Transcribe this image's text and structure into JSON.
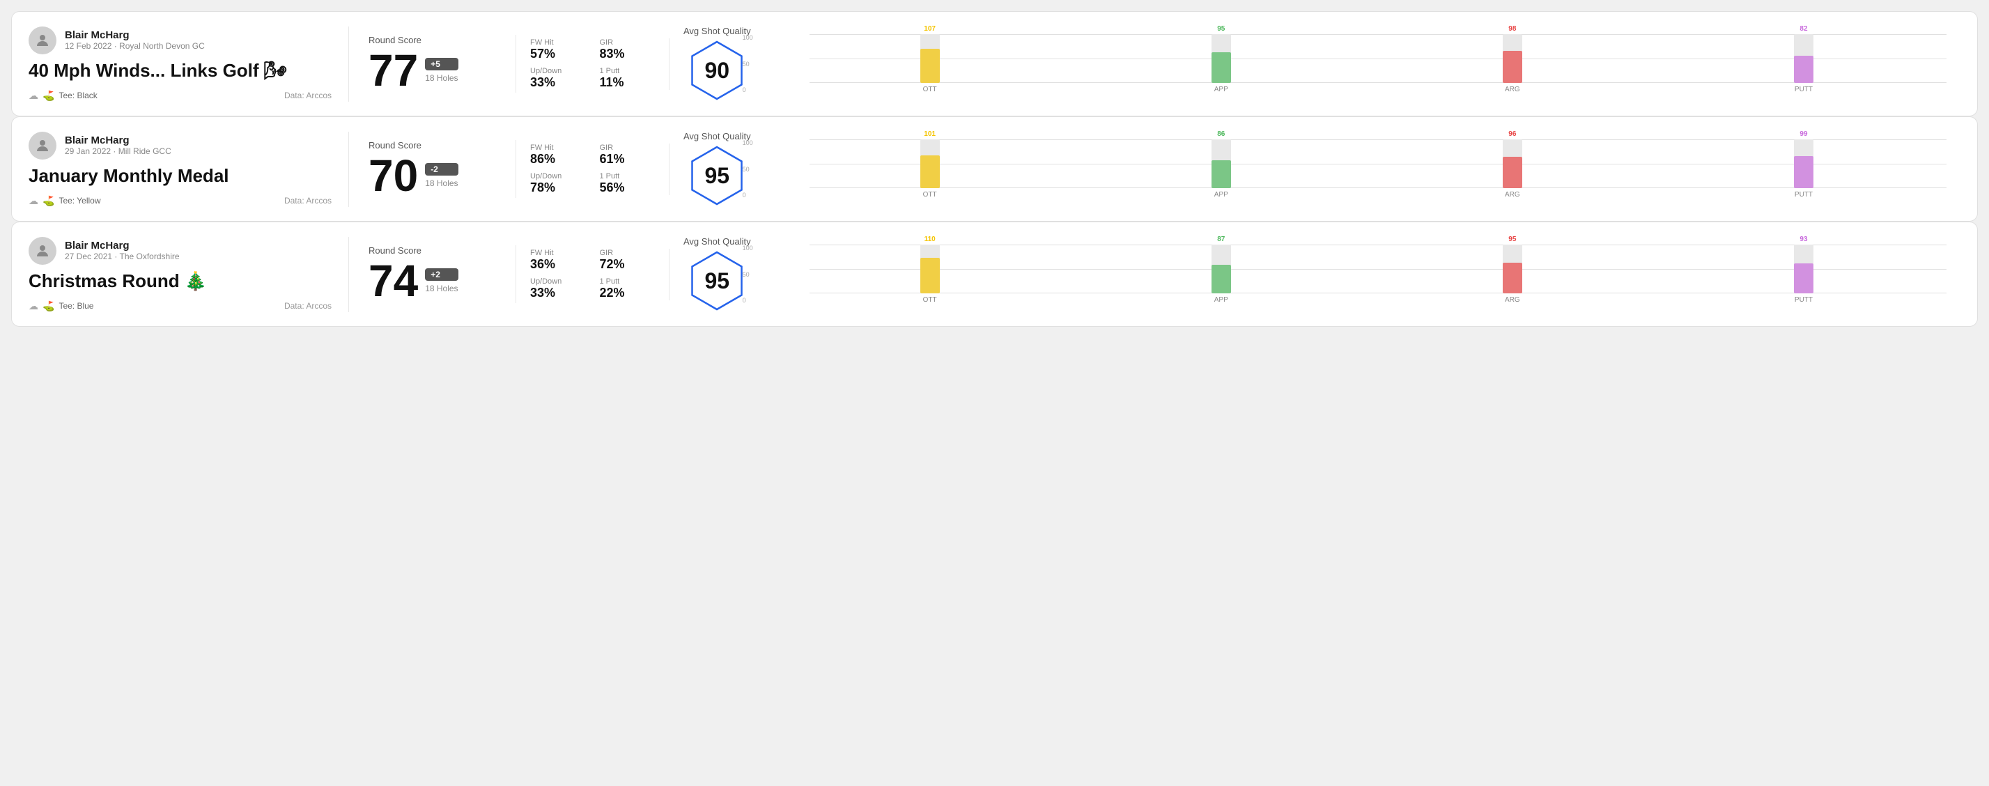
{
  "rounds": [
    {
      "id": "round1",
      "user": {
        "name": "Blair McHarg",
        "date": "12 Feb 2022 · Royal North Devon GC"
      },
      "title": "40 Mph Winds... Links Golf 🌬",
      "tee": "Black",
      "data_source": "Data: Arccos",
      "score": {
        "value": "77",
        "modifier": "+5",
        "modifier_type": "over",
        "holes": "18 Holes"
      },
      "stats": {
        "fw_hit_label": "FW Hit",
        "fw_hit_value": "57%",
        "gir_label": "GIR",
        "gir_value": "83%",
        "updown_label": "Up/Down",
        "updown_value": "33%",
        "oneputt_label": "1 Putt",
        "oneputt_value": "11%"
      },
      "quality": {
        "label": "Avg Shot Quality",
        "score": "90"
      },
      "bars": {
        "max": 100,
        "items": [
          {
            "label": "OTT",
            "value": 107,
            "color": "#f5c400",
            "height_pct": 70
          },
          {
            "label": "APP",
            "value": 95,
            "color": "#4db85c",
            "height_pct": 63
          },
          {
            "label": "ARG",
            "value": 98,
            "color": "#e84444",
            "height_pct": 65
          },
          {
            "label": "PUTT",
            "value": 82,
            "color": "#c96cdd",
            "height_pct": 55
          }
        ]
      }
    },
    {
      "id": "round2",
      "user": {
        "name": "Blair McHarg",
        "date": "29 Jan 2022 · Mill Ride GCC"
      },
      "title": "January Monthly Medal",
      "tee": "Yellow",
      "data_source": "Data: Arccos",
      "score": {
        "value": "70",
        "modifier": "-2",
        "modifier_type": "under",
        "holes": "18 Holes"
      },
      "stats": {
        "fw_hit_label": "FW Hit",
        "fw_hit_value": "86%",
        "gir_label": "GIR",
        "gir_value": "61%",
        "updown_label": "Up/Down",
        "updown_value": "78%",
        "oneputt_label": "1 Putt",
        "oneputt_value": "56%"
      },
      "quality": {
        "label": "Avg Shot Quality",
        "score": "95"
      },
      "bars": {
        "max": 100,
        "items": [
          {
            "label": "OTT",
            "value": 101,
            "color": "#f5c400",
            "height_pct": 67
          },
          {
            "label": "APP",
            "value": 86,
            "color": "#4db85c",
            "height_pct": 57
          },
          {
            "label": "ARG",
            "value": 96,
            "color": "#e84444",
            "height_pct": 64
          },
          {
            "label": "PUTT",
            "value": 99,
            "color": "#c96cdd",
            "height_pct": 66
          }
        ]
      }
    },
    {
      "id": "round3",
      "user": {
        "name": "Blair McHarg",
        "date": "27 Dec 2021 · The Oxfordshire"
      },
      "title": "Christmas Round 🎄",
      "tee": "Blue",
      "data_source": "Data: Arccos",
      "score": {
        "value": "74",
        "modifier": "+2",
        "modifier_type": "over",
        "holes": "18 Holes"
      },
      "stats": {
        "fw_hit_label": "FW Hit",
        "fw_hit_value": "36%",
        "gir_label": "GIR",
        "gir_value": "72%",
        "updown_label": "Up/Down",
        "updown_value": "33%",
        "oneputt_label": "1 Putt",
        "oneputt_value": "22%"
      },
      "quality": {
        "label": "Avg Shot Quality",
        "score": "95"
      },
      "bars": {
        "max": 100,
        "items": [
          {
            "label": "OTT",
            "value": 110,
            "color": "#f5c400",
            "height_pct": 73
          },
          {
            "label": "APP",
            "value": 87,
            "color": "#4db85c",
            "height_pct": 58
          },
          {
            "label": "ARG",
            "value": 95,
            "color": "#e84444",
            "height_pct": 63
          },
          {
            "label": "PUTT",
            "value": 93,
            "color": "#c96cdd",
            "height_pct": 62
          }
        ]
      }
    }
  ],
  "chart_y_labels": [
    "100",
    "50",
    "0"
  ]
}
